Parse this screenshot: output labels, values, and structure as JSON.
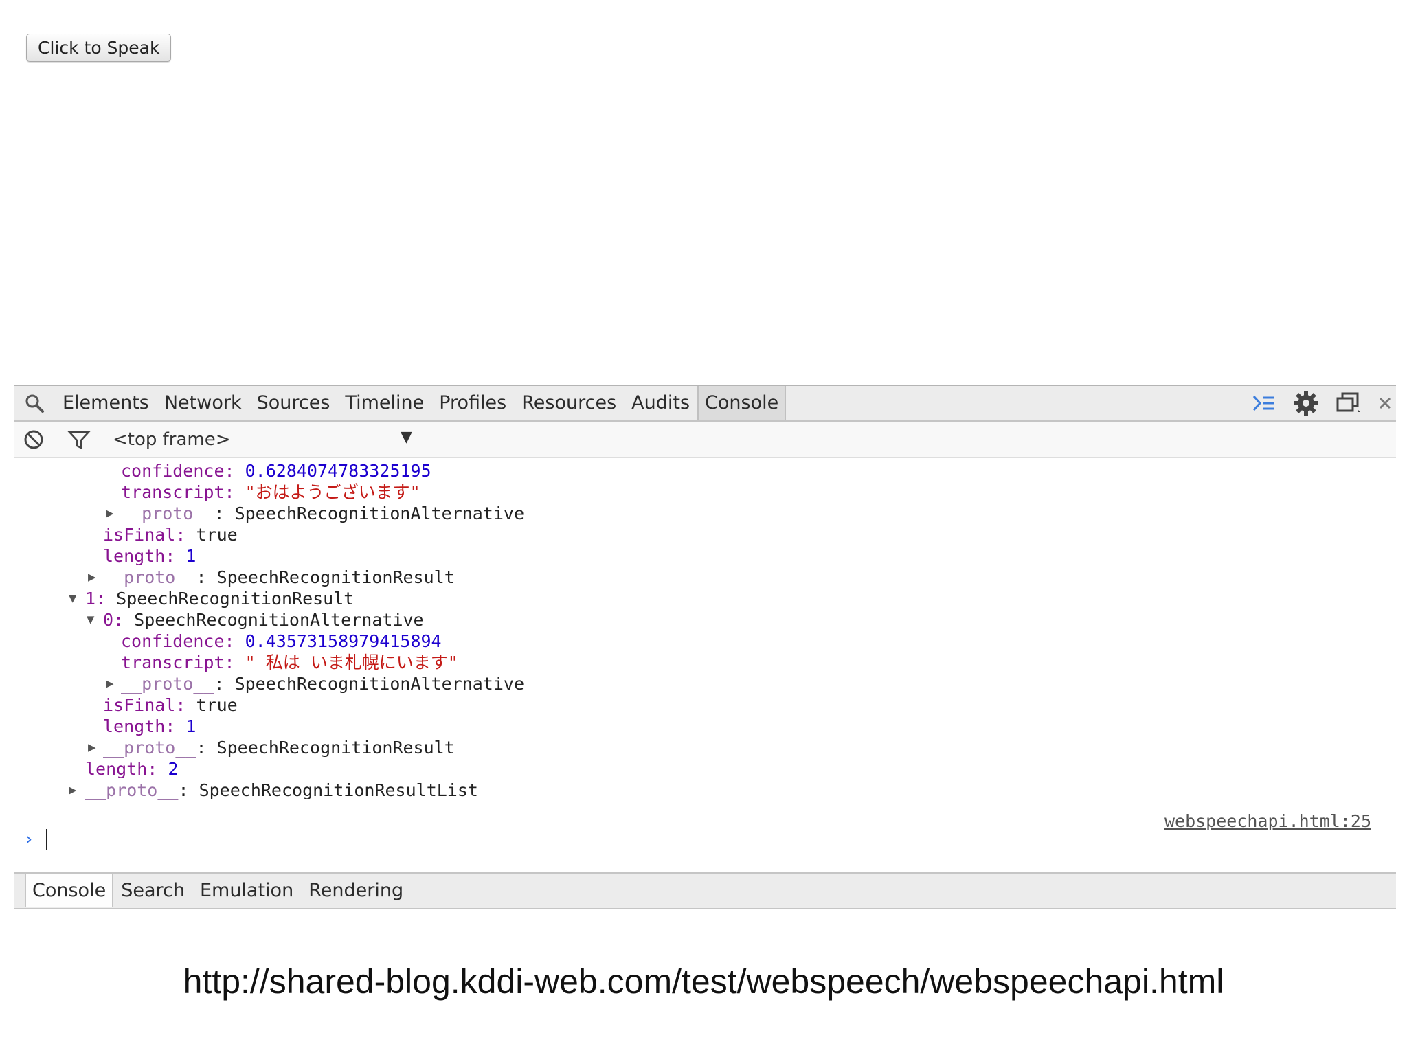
{
  "page": {
    "speak_button": "Click to Speak"
  },
  "devtools": {
    "tabs": [
      "Elements",
      "Network",
      "Sources",
      "Timeline",
      "Profiles",
      "Resources",
      "Audits",
      "Console"
    ],
    "active_tab": "Console",
    "frame_selector": "<top frame>",
    "console_lines": [
      {
        "key": "confidence: ",
        "value": "0.6284074783325195",
        "kind": "num"
      },
      {
        "key": "transcript: ",
        "value": "\"おはようございます\"",
        "kind": "str"
      },
      {
        "key": "__proto__",
        "value": ": SpeechRecognitionAlternative",
        "kind": "proto"
      },
      {
        "key": "isFinal: ",
        "value": "true",
        "kind": "plain"
      },
      {
        "key": "length: ",
        "value": "1",
        "kind": "num"
      },
      {
        "key": "__proto__",
        "value": ": SpeechRecognitionResult",
        "kind": "proto"
      },
      {
        "key": "1: ",
        "value": "SpeechRecognitionResult",
        "kind": "plain"
      },
      {
        "key": "0: ",
        "value": "SpeechRecognitionAlternative",
        "kind": "plain"
      },
      {
        "key": "confidence: ",
        "value": "0.43573158979415894",
        "kind": "num"
      },
      {
        "key": "transcript: ",
        "value": "\" 私は いま札幌にいます\"",
        "kind": "str"
      },
      {
        "key": "__proto__",
        "value": ": SpeechRecognitionAlternative",
        "kind": "proto"
      },
      {
        "key": "isFinal: ",
        "value": "true",
        "kind": "plain"
      },
      {
        "key": "length: ",
        "value": "1",
        "kind": "num"
      },
      {
        "key": "__proto__",
        "value": ": SpeechRecognitionResult",
        "kind": "proto"
      },
      {
        "key": "length: ",
        "value": "2",
        "kind": "num"
      },
      {
        "key": "__proto__",
        "value": ": SpeechRecognitionResultList",
        "kind": "proto"
      }
    ],
    "source_link": "webspeechapi.html:25",
    "prompt_symbol": "›",
    "drawer_tabs": [
      "Console",
      "Search",
      "Emulation",
      "Rendering"
    ],
    "drawer_active": "Console",
    "icons": [
      "search-icon",
      "drawer-toggle-icon",
      "gear-icon",
      "undock-icon",
      "close-icon",
      "clear-console-icon",
      "filter-icon"
    ],
    "colors": {
      "key": "#881391",
      "number": "#1c00cf",
      "string": "#c41a16",
      "prompt": "#2d6ee6"
    }
  },
  "caption": {
    "url": "http://shared-blog.kddi-web.com/test/webspeech/webspeechapi.html"
  }
}
